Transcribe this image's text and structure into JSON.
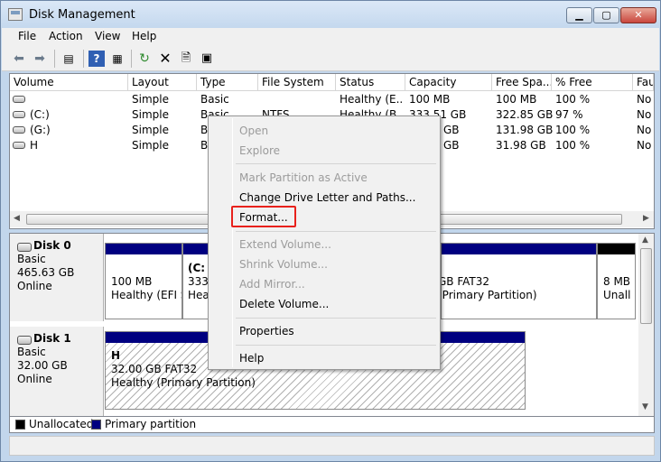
{
  "window": {
    "title": "Disk Management"
  },
  "menu": [
    "File",
    "Action",
    "View",
    "Help"
  ],
  "toolbar_icons": [
    "back-icon",
    "forward-icon",
    "show-hide-tree-icon",
    "help-icon",
    "show-hide-action-pane-icon",
    "refresh-icon",
    "delete-icon",
    "properties-icon",
    "rescan-icon"
  ],
  "columns": [
    "Volume",
    "Layout",
    "Type",
    "File System",
    "Status",
    "Capacity",
    "Free Spa...",
    "% Free",
    "Fau"
  ],
  "volumes": [
    {
      "volume": "",
      "layout": "Simple",
      "type": "Basic",
      "fs": "",
      "status": "Healthy (E...",
      "capacity": "100 MB",
      "free": "100 MB",
      "pct": "100 %",
      "fault": "No"
    },
    {
      "volume": "(C:)",
      "layout": "Simple",
      "type": "Basic",
      "fs": "NTFS",
      "status": "Healthy (B...",
      "capacity": "333.51 GB",
      "free": "322.85 GB",
      "pct": "97 %",
      "fault": "No"
    },
    {
      "volume": "(G:)",
      "layout": "Simple",
      "type": "B",
      "fs": "",
      "status": "",
      "capacity": "GB",
      "free": "131.98 GB",
      "pct": "100 %",
      "fault": "No"
    },
    {
      "volume": "H",
      "layout": "Simple",
      "type": "B",
      "fs": "",
      "status": "",
      "capacity": "GB",
      "free": "31.98 GB",
      "pct": "100 %",
      "fault": "No"
    }
  ],
  "disks": [
    {
      "name": "Disk 0",
      "type": "Basic",
      "size": "465.63 GB",
      "state": "Online",
      "partitions": [
        {
          "line1": "100 MB",
          "line2": "Healthy (EFI S"
        },
        {
          "line0": "(C:",
          "line1": "333.",
          "line2": "Hea"
        },
        {
          "line1": "GB FAT32",
          "line2": "(Primary Partition)"
        },
        {
          "line1": "8 MB",
          "line2": "Unall"
        }
      ]
    },
    {
      "name": "Disk 1",
      "type": "Basic",
      "size": "32.00 GB",
      "state": "Online",
      "partitions": [
        {
          "line0": "H",
          "line1": "32.00 GB FAT32",
          "line2": "Healthy (Primary Partition)"
        }
      ]
    }
  ],
  "legend": [
    "Unallocated",
    "Primary partition"
  ],
  "colors": {
    "primary": "#000080",
    "unallocated": "#000000",
    "highlight": "#e8211c"
  },
  "context_menu": {
    "items": [
      "Open",
      "Explore",
      "Mark Partition as Active",
      "Change Drive Letter and Paths...",
      "Format...",
      "Extend Volume...",
      "Shrink Volume...",
      "Add Mirror...",
      "Delete Volume...",
      "Properties",
      "Help"
    ],
    "highlighted": "Format..."
  }
}
